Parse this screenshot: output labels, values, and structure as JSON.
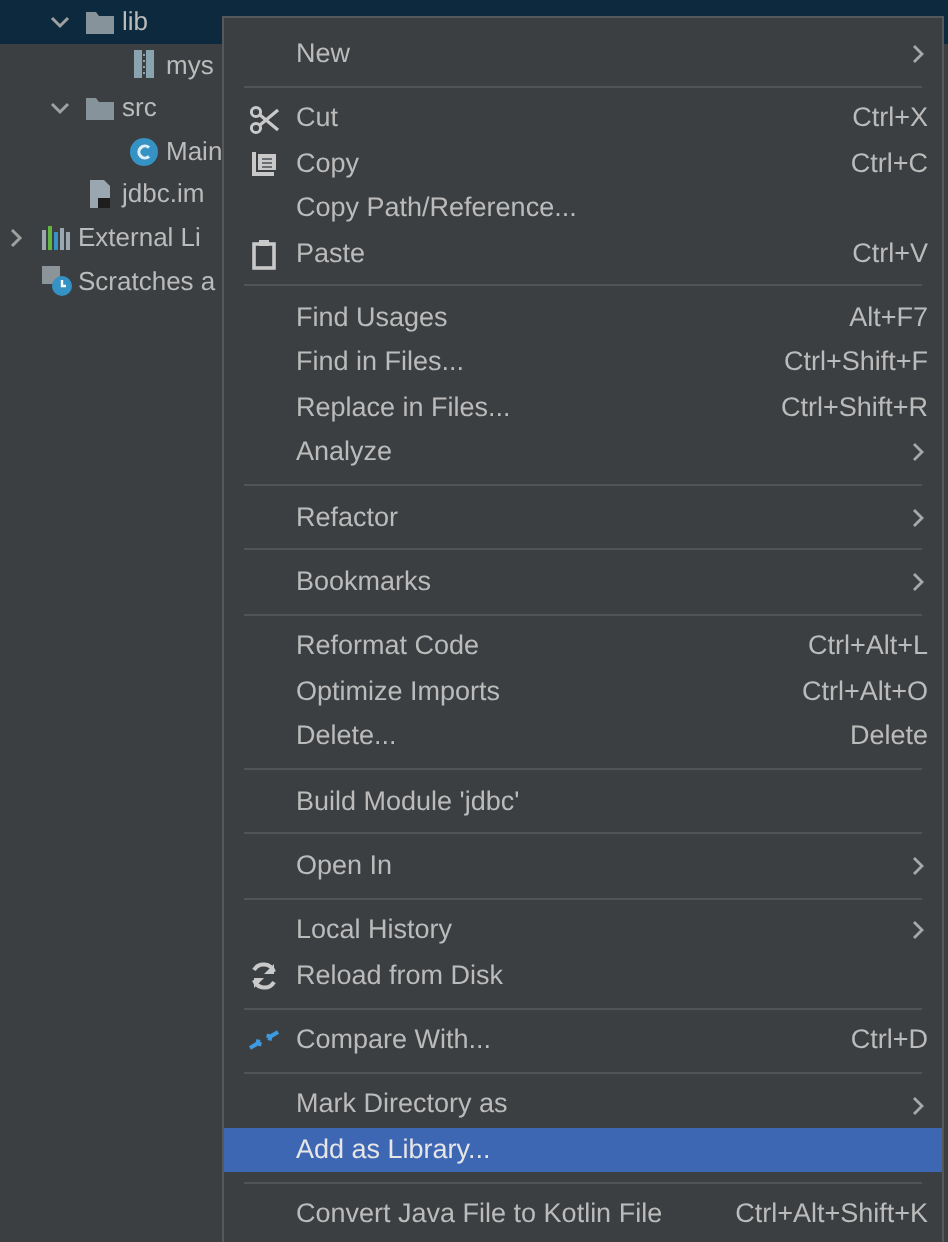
{
  "tree": {
    "project_children": [
      {
        "label": "lib",
        "kind": "folder",
        "selected": true,
        "expanded": true,
        "children": [
          {
            "label": "mys",
            "kind": "jar",
            "selected": false
          }
        ]
      },
      {
        "label": "src",
        "kind": "folder",
        "selected": false,
        "expanded": true,
        "children": [
          {
            "label": "Main",
            "kind": "class",
            "selected": false
          }
        ]
      },
      {
        "label": "jdbc.im",
        "kind": "iml",
        "selected": false
      }
    ],
    "roots": [
      {
        "label": "External Li",
        "kind": "libraries",
        "selected": false,
        "expanded": false
      },
      {
        "label": "Scratches a",
        "kind": "scratches",
        "selected": false
      }
    ]
  },
  "context_menu": {
    "items": [
      {
        "kind": "item",
        "label": "New",
        "submenu": true,
        "selected": false
      },
      {
        "kind": "separator"
      },
      {
        "kind": "item",
        "label": "Cut",
        "shortcut": "Ctrl+X",
        "selected": false
      },
      {
        "kind": "item",
        "label": "Copy",
        "shortcut": "Ctrl+C",
        "selected": false
      },
      {
        "kind": "item",
        "label": "Copy Path/Reference...",
        "selected": false
      },
      {
        "kind": "item",
        "label": "Paste",
        "shortcut": "Ctrl+V",
        "selected": false
      },
      {
        "kind": "separator"
      },
      {
        "kind": "item",
        "label": "Find Usages",
        "shortcut": "Alt+F7",
        "selected": false
      },
      {
        "kind": "item",
        "label": "Find in Files...",
        "shortcut": "Ctrl+Shift+F",
        "selected": false
      },
      {
        "kind": "item",
        "label": "Replace in Files...",
        "shortcut": "Ctrl+Shift+R",
        "selected": false
      },
      {
        "kind": "item",
        "label": "Analyze",
        "submenu": true,
        "selected": false
      },
      {
        "kind": "separator"
      },
      {
        "kind": "item",
        "label": "Refactor",
        "submenu": true,
        "selected": false
      },
      {
        "kind": "separator"
      },
      {
        "kind": "item",
        "label": "Bookmarks",
        "submenu": true,
        "selected": false
      },
      {
        "kind": "separator"
      },
      {
        "kind": "item",
        "label": "Reformat Code",
        "shortcut": "Ctrl+Alt+L",
        "selected": false
      },
      {
        "kind": "item",
        "label": "Optimize Imports",
        "shortcut": "Ctrl+Alt+O",
        "selected": false
      },
      {
        "kind": "item",
        "label": "Delete...",
        "shortcut": "Delete",
        "selected": false
      },
      {
        "kind": "separator"
      },
      {
        "kind": "item",
        "label": "Build Module 'jdbc'",
        "selected": false
      },
      {
        "kind": "separator"
      },
      {
        "kind": "item",
        "label": "Open In",
        "submenu": true,
        "selected": false
      },
      {
        "kind": "separator"
      },
      {
        "kind": "item",
        "label": "Local History",
        "submenu": true,
        "selected": false
      },
      {
        "kind": "item",
        "label": "Reload from Disk",
        "selected": false
      },
      {
        "kind": "separator"
      },
      {
        "kind": "item",
        "label": "Compare With...",
        "shortcut": "Ctrl+D",
        "selected": false
      },
      {
        "kind": "separator"
      },
      {
        "kind": "item",
        "label": "Mark Directory as",
        "submenu": true,
        "selected": false
      },
      {
        "kind": "item",
        "label": "Add as Library...",
        "selected": true
      },
      {
        "kind": "separator"
      },
      {
        "kind": "item",
        "label": "Convert Java File to Kotlin File",
        "shortcut": "Ctrl+Alt+Shift+K",
        "selected": false
      }
    ]
  }
}
